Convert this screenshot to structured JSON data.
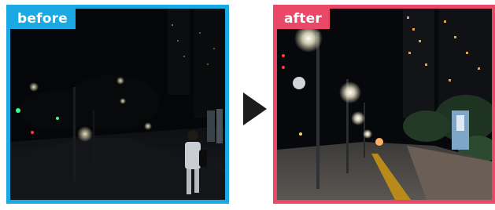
{
  "panels": [
    {
      "label": "before",
      "color": "#1aa9e3",
      "description_icon": "night-street-dark-photo"
    },
    {
      "label": "after",
      "color": "#e94867",
      "description_icon": "night-street-bright-photo"
    }
  ],
  "arrow": {
    "icon": "play-right-icon",
    "color": "#1c1c1c"
  }
}
